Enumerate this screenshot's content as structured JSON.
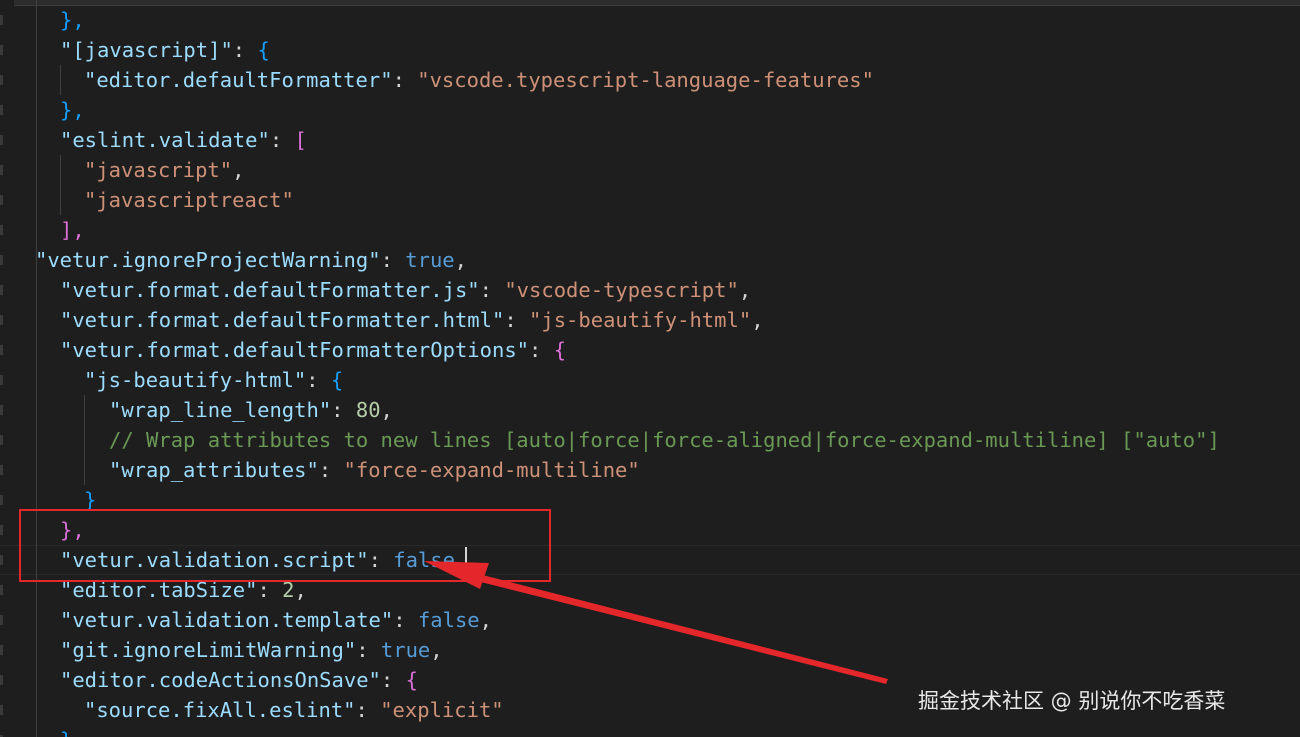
{
  "editor": {
    "lines": [
      [
        [
          "b3",
          "},"
        ]
      ],
      [
        [
          "key",
          "\"[javascript]\""
        ],
        [
          "p",
          ": "
        ],
        [
          "b3",
          "{"
        ]
      ],
      [
        [
          "key",
          "\"editor.defaultFormatter\""
        ],
        [
          "p",
          ": "
        ],
        [
          "str",
          "\"vscode.typescript-language-features\""
        ]
      ],
      [
        [
          "b3",
          "},"
        ]
      ],
      [
        [
          "key",
          "\"eslint.validate\""
        ],
        [
          "p",
          ": "
        ],
        [
          "b2",
          "["
        ]
      ],
      [
        [
          "str",
          "\"javascript\""
        ],
        [
          "p",
          ","
        ]
      ],
      [
        [
          "str",
          "\"javascriptreact\""
        ]
      ],
      [
        [
          "b2",
          "],"
        ]
      ],
      [
        [
          "key",
          "\"vetur.ignoreProjectWarning\""
        ],
        [
          "p",
          ": "
        ],
        [
          "kw",
          "true"
        ],
        [
          "p",
          ","
        ]
      ],
      [
        [
          "key",
          "\"vetur.format.defaultFormatter.js\""
        ],
        [
          "p",
          ": "
        ],
        [
          "str",
          "\"vscode-typescript\""
        ],
        [
          "p",
          ","
        ]
      ],
      [
        [
          "key",
          "\"vetur.format.defaultFormatter.html\""
        ],
        [
          "p",
          ": "
        ],
        [
          "str",
          "\"js-beautify-html\""
        ],
        [
          "p",
          ","
        ]
      ],
      [
        [
          "key",
          "\"vetur.format.defaultFormatterOptions\""
        ],
        [
          "p",
          ": "
        ],
        [
          "b2",
          "{"
        ]
      ],
      [
        [
          "key",
          "\"js-beautify-html\""
        ],
        [
          "p",
          ": "
        ],
        [
          "b3",
          "{"
        ]
      ],
      [
        [
          "key",
          "\"wrap_line_length\""
        ],
        [
          "p",
          ": "
        ],
        [
          "num",
          "80"
        ],
        [
          "p",
          ","
        ]
      ],
      [
        [
          "cmt",
          "// Wrap attributes to new lines [auto|force|force-aligned|force-expand-multiline] [\"auto\"]"
        ]
      ],
      [
        [
          "key",
          "\"wrap_attributes\""
        ],
        [
          "p",
          ": "
        ],
        [
          "str",
          "\"force-expand-multiline\""
        ]
      ],
      [
        [
          "b3",
          "}"
        ]
      ],
      [
        [
          "b2",
          "},"
        ]
      ],
      [
        [
          "key",
          "\"vetur.validation.script\""
        ],
        [
          "p",
          ": "
        ],
        [
          "kw",
          "false"
        ],
        [
          "p",
          ","
        ]
      ],
      [
        [
          "key",
          "\"editor.tabSize\""
        ],
        [
          "p",
          ": "
        ],
        [
          "num",
          "2"
        ],
        [
          "p",
          ","
        ]
      ],
      [
        [
          "key",
          "\"vetur.validation.template\""
        ],
        [
          "p",
          ": "
        ],
        [
          "kw",
          "false"
        ],
        [
          "p",
          ","
        ]
      ],
      [
        [
          "key",
          "\"git.ignoreLimitWarning\""
        ],
        [
          "p",
          ": "
        ],
        [
          "kw",
          "true"
        ],
        [
          "p",
          ","
        ]
      ],
      [
        [
          "key",
          "\"editor.codeActionsOnSave\""
        ],
        [
          "p",
          ": "
        ],
        [
          "b2",
          "{"
        ]
      ],
      [
        [
          "key",
          "\"source.fixAll.eslint\""
        ],
        [
          "p",
          ": "
        ],
        [
          "str",
          "\"explicit\""
        ]
      ],
      [
        [
          "b3",
          "}"
        ]
      ]
    ]
  },
  "watermark": "掘金技术社区 @ 别说你不吃香菜",
  "colors": {
    "background": "#1e1e1e",
    "key": "#9cdcfe",
    "string": "#ce9178",
    "keyword": "#569cd6",
    "number": "#b5cea8",
    "comment": "#6a9955",
    "annotation": "#e3272a"
  }
}
